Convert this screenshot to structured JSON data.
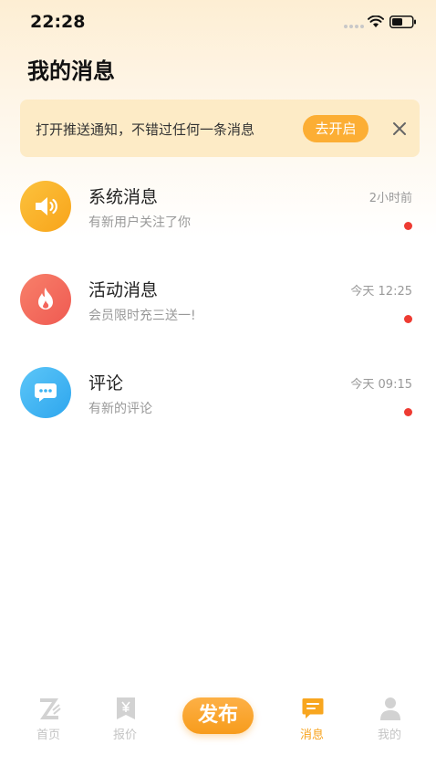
{
  "status_bar": {
    "time": "22:28"
  },
  "page": {
    "title": "我的消息"
  },
  "notify_banner": {
    "text": "打开推送通知，不错过任何一条消息",
    "button_label": "去开启"
  },
  "messages": [
    {
      "title": "系统消息",
      "subtitle": "有新用户关注了你",
      "time": "2小时前",
      "icon": "speaker-icon",
      "color": "#fbab26",
      "unread": true
    },
    {
      "title": "活动消息",
      "subtitle": "会员限时充三送一!",
      "time": "今天 12:25",
      "icon": "flame-icon",
      "color": "#f4655c",
      "unread": true
    },
    {
      "title": "评论",
      "subtitle": "有新的评论",
      "time": "今天 09:15",
      "icon": "chat-bubble-icon",
      "color": "#3cb3f3",
      "unread": true
    }
  ],
  "tabbar": {
    "items": [
      {
        "label": "首页",
        "icon": "home-z-icon",
        "active": false
      },
      {
        "label": "报价",
        "icon": "price-tag-icon",
        "active": false
      },
      {
        "label": "消息",
        "icon": "message-icon",
        "active": true
      },
      {
        "label": "我的",
        "icon": "profile-icon",
        "active": false
      }
    ],
    "publish_label": "发布"
  },
  "colors": {
    "accent": "#f7a21b",
    "banner_bg": "#fdebc6",
    "unread_dot": "#ee3b32"
  }
}
